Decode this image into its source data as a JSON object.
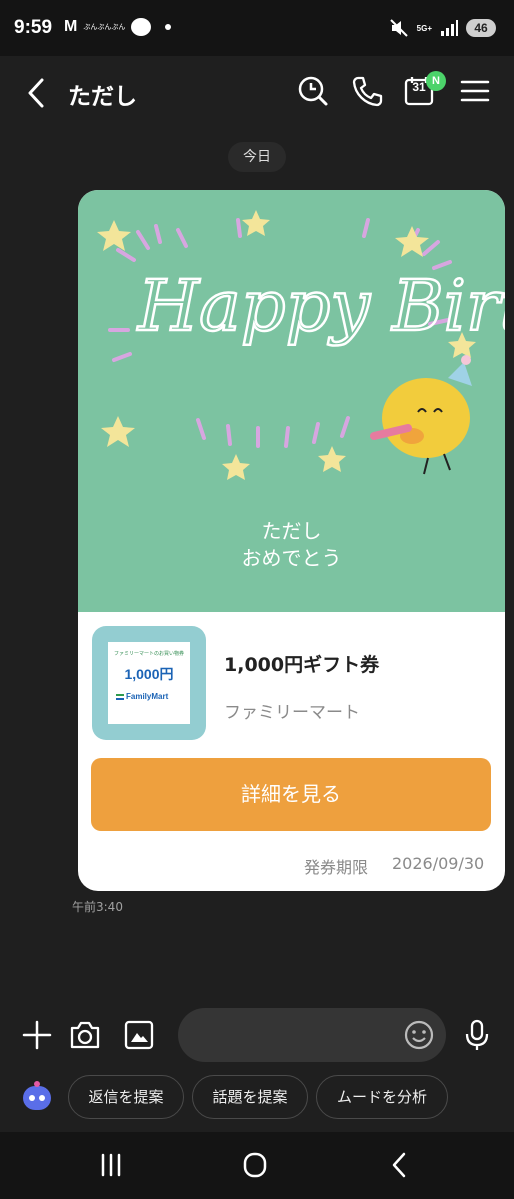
{
  "status_bar": {
    "time": "9:59",
    "gmail_icon": "gmail-icon",
    "app_label_line1": "ぷんぷんぷん",
    "network": "5G+",
    "battery": "46"
  },
  "header": {
    "title": "ただし",
    "calendar_day": "31",
    "calendar_badge": "N",
    "icons": [
      "back-arrow-icon",
      "search-icon",
      "phone-icon",
      "calendar-icon",
      "menu-icon"
    ]
  },
  "date_chip": "今日",
  "gift_card": {
    "banner_message_line1": "ただし",
    "banner_message_line2": "おめでとう",
    "art_text": "Happy Birthday",
    "thumbnail": {
      "caption": "ファミリーマートのお買い物券",
      "amount": "1,000円",
      "brand": "FamilyMart"
    },
    "title": "1,000円ギフト券",
    "brand": "ファミリーマート",
    "details_button": "詳細を見る",
    "expiry_label": "発券期限",
    "expiry_date": "2026/09/30",
    "colors": {
      "banner": "#7cc3a1",
      "button": "#eea03e",
      "thumb_frame": "#93cdd1"
    }
  },
  "message_time": "午前3:40",
  "input_bar": {
    "placeholder": "",
    "suggestions": [
      "返信を提案",
      "話題を提案",
      "ムードを分析"
    ]
  },
  "nav_bar": {
    "icons": [
      "recent-apps-icon",
      "home-icon",
      "back-icon"
    ]
  }
}
